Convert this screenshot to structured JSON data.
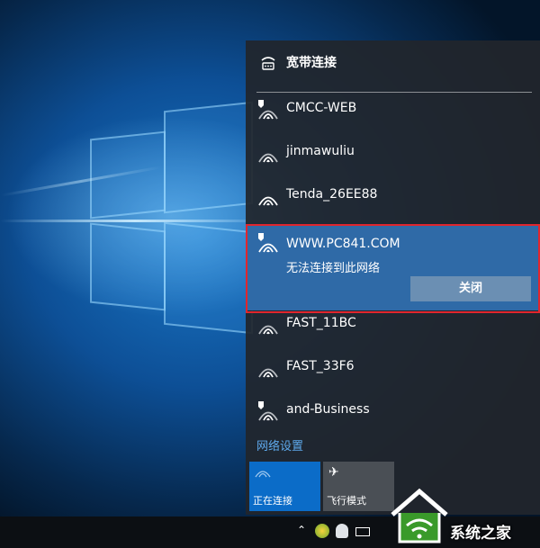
{
  "flyout": {
    "broadband": {
      "label": "宽带连接",
      "icon": "dialup-icon"
    },
    "networks": [
      {
        "name": "CMCC-WEB",
        "secured": false
      },
      {
        "name": "jinmawuliu",
        "secured": true
      },
      {
        "name": "Tenda_26EE88",
        "secured": true
      }
    ],
    "selected": {
      "name": "WWW.PC841.COM",
      "message": "无法连接到此网络",
      "close_label": "关闭",
      "secured": false
    },
    "networks_after": [
      {
        "name": "FAST_11BC",
        "secured": true
      },
      {
        "name": "FAST_33F6",
        "secured": true
      },
      {
        "name": "and-Business",
        "secured": false
      }
    ],
    "settings_link": "网络设置",
    "tiles": [
      {
        "label": "正在连接",
        "icon": "wifi-icon",
        "active": true
      },
      {
        "label": "飞行模式",
        "icon": "airplane-icon",
        "active": false
      }
    ]
  },
  "watermark": {
    "text": "系统之家"
  },
  "colors": {
    "accent": "#0078d7",
    "link": "#5ea9ec",
    "highlight_border": "#e0262e",
    "flyout_bg": "#21262c"
  }
}
